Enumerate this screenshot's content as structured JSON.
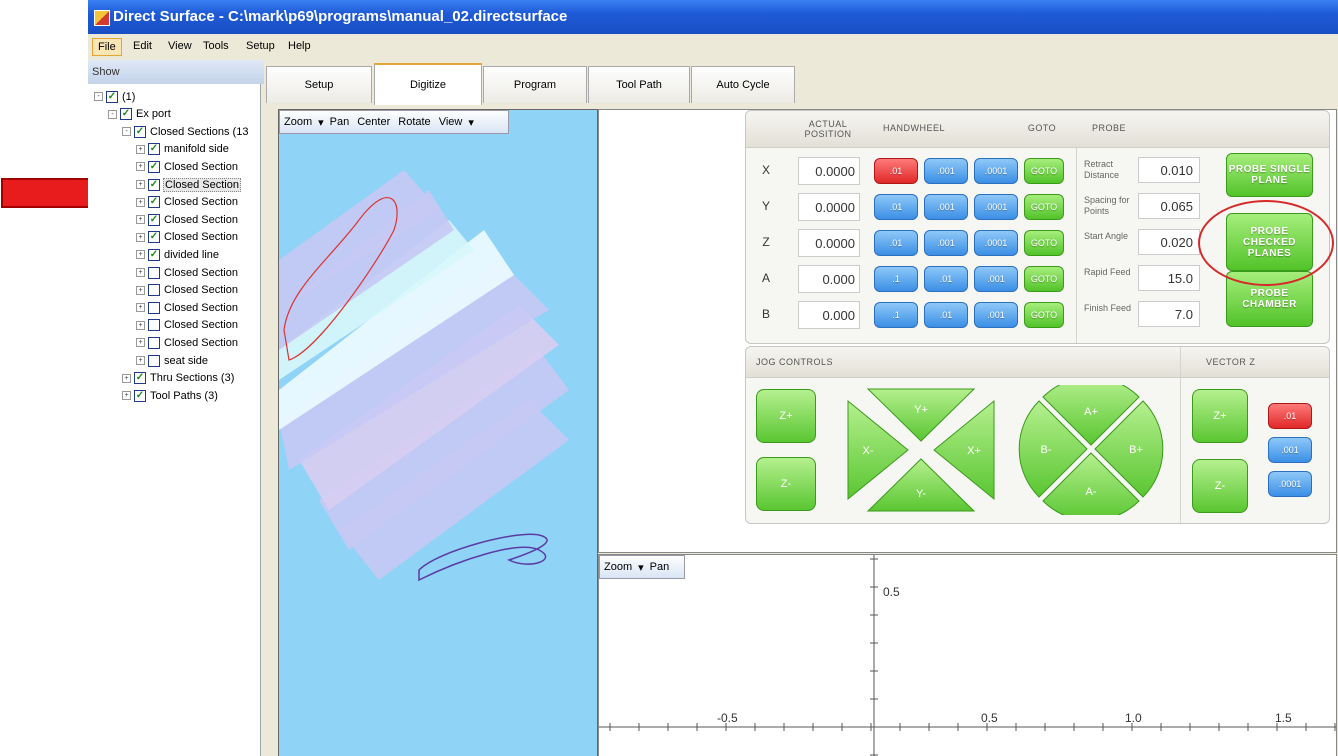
{
  "window": {
    "title": "Direct Surface - C:\\mark\\p69\\programs\\manual_02.directsurface"
  },
  "menu": [
    "File",
    "Edit",
    "View",
    "Tools",
    "Setup",
    "Help"
  ],
  "panel": {
    "header": "Show"
  },
  "tree": [
    {
      "label": "(1)",
      "checked": true,
      "expander": "-"
    },
    {
      "label": "Ex port",
      "checked": true,
      "expander": "-"
    },
    {
      "label": "Closed Sections (13",
      "checked": true,
      "expander": "-"
    },
    {
      "label": "manifold side",
      "checked": true,
      "expander": "+"
    },
    {
      "label": "Closed Section",
      "checked": true,
      "expander": "+"
    },
    {
      "label": "Closed Section",
      "checked": true,
      "expander": "+"
    },
    {
      "label": "Closed Section",
      "checked": true,
      "expander": "+"
    },
    {
      "label": "Closed Section",
      "checked": true,
      "expander": "+"
    },
    {
      "label": "Closed Section",
      "checked": true,
      "expander": "+"
    },
    {
      "label": "divided line",
      "checked": true,
      "expander": "+"
    },
    {
      "label": "Closed Section",
      "checked": false,
      "expander": "+"
    },
    {
      "label": "Closed Section",
      "checked": false,
      "expander": "+"
    },
    {
      "label": "Closed Section",
      "checked": false,
      "expander": "+"
    },
    {
      "label": "Closed Section",
      "checked": false,
      "expander": "+"
    },
    {
      "label": "Closed Section",
      "checked": false,
      "expander": "+"
    },
    {
      "label": "seat side",
      "checked": false,
      "expander": "+"
    },
    {
      "label": "Thru Sections (3)",
      "checked": true,
      "expander": "+"
    },
    {
      "label": "Tool Paths (3)",
      "checked": true,
      "expander": "+"
    }
  ],
  "tabs": [
    "Setup",
    "Digitize",
    "Program",
    "Tool Path",
    "Auto Cycle"
  ],
  "view3d_toolbar": [
    "Zoom",
    "▾",
    "Pan",
    "Center",
    "Rotate",
    "View",
    "▾"
  ],
  "digitize": {
    "headers": {
      "actual": "ACTUAL POSITION",
      "handwheel": "HANDWHEEL",
      "goto": "GOTO",
      "probe": "PROBE"
    },
    "axes": [
      {
        "axis": "X",
        "value": "0.0000",
        "steps": [
          ".01",
          ".001",
          ".0001"
        ],
        "active": 0
      },
      {
        "axis": "Y",
        "value": "0.0000",
        "steps": [
          ".01",
          ".001",
          ".0001"
        ],
        "active": -1
      },
      {
        "axis": "Z",
        "value": "0.0000",
        "steps": [
          ".01",
          ".001",
          ".0001"
        ],
        "active": -1
      },
      {
        "axis": "A",
        "value": "0.000",
        "steps": [
          ".1",
          ".01",
          ".001"
        ],
        "active": -1
      },
      {
        "axis": "B",
        "value": "0.000",
        "steps": [
          ".1",
          ".01",
          ".001"
        ],
        "active": -1
      }
    ],
    "goto_label": "GOTO",
    "probe_params": [
      {
        "label": "Retract Distance",
        "value": "0.010"
      },
      {
        "label": "Spacing for Points",
        "value": "0.065"
      },
      {
        "label": "Start Angle",
        "value": "0.020"
      },
      {
        "label": "Rapid Feed",
        "value": "15.0"
      },
      {
        "label": "Finish Feed",
        "value": "7.0"
      }
    ],
    "probe_buttons": [
      "PROBE SINGLE PLANE",
      "PROBE CHECKED PLANES",
      "PROBE CHAMBER"
    ]
  },
  "jog": {
    "title": "JOG CONTROLS",
    "vector_title": "VECTOR Z",
    "z_plus": "Z+",
    "z_minus": "Z-",
    "xy": {
      "up": "Y+",
      "down": "Y-",
      "left": "X-",
      "right": "X+"
    },
    "ab": {
      "up": "A+",
      "down": "A-",
      "left": "B-",
      "right": "B+"
    },
    "vector_z_plus": "Z+",
    "vector_z_minus": "Z-",
    "vector_steps": [
      ".01",
      ".001",
      ".0001"
    ]
  },
  "plot2d": {
    "toolbar": [
      "Zoom",
      "▾",
      "Pan"
    ],
    "y_label": "0.5",
    "x_labels": [
      "-0.5",
      "0.5",
      "1.0",
      "1.5"
    ]
  },
  "colors": {
    "green": "#52c329",
    "blue": "#3b8fe5",
    "red": "#e02828",
    "annotation": "#d62a2a"
  }
}
